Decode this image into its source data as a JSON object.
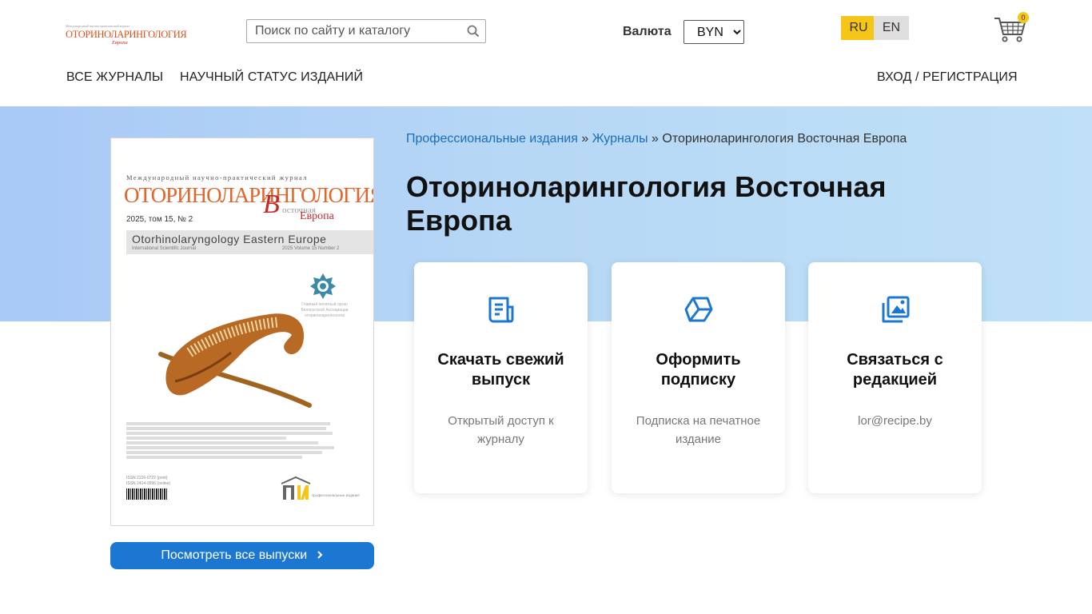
{
  "header": {
    "logo": {
      "small": "Международный научно-практический журнал",
      "main": "ОТОРИНОЛАРИНГОЛОГИЯ",
      "sub": "Европа"
    },
    "search": {
      "placeholder": "Поиск по сайту и каталогу"
    },
    "currency": {
      "label": "Валюта",
      "selected": "BYN"
    },
    "languages": [
      {
        "code": "RU",
        "active": true
      },
      {
        "code": "EN",
        "active": false
      }
    ],
    "cart": {
      "count": "0"
    },
    "nav": [
      {
        "label": "ВСЕ ЖУРНАЛЫ"
      },
      {
        "label": "НАУЧНЫЙ СТАТУС ИЗДАНИЙ"
      }
    ],
    "auth_label": "ВХОД / РЕГИСТРАЦИЯ"
  },
  "cover": {
    "intl": "Международный научно-практический журнал",
    "title": "ОТОРИНОЛАРИНГОЛОГИЯ",
    "b_letter": "В",
    "vostochnaya": "осточная",
    "evropa": "Европа",
    "year": "2025, том 15, № 2",
    "en_title": "Otorhinolaryngology  Eastern  Europe",
    "en_sub": "International Scientific Journal",
    "en_vol": "2025  Volume 15  Number 2",
    "org": "Главный печатный орган Белорусской Ассоциации оториноларингологов",
    "issn": "ISSN 2226-0722 (print)\nISSN 2414-3596 (online)",
    "publisher": "профессиональные издания"
  },
  "all_issues_label": "Посмотреть все выпуски",
  "breadcrumb": {
    "items": [
      "Профессиональные издания",
      "Журналы"
    ],
    "separator": "»",
    "current": "Оториноларингология Восточная Европа"
  },
  "page_title": "Оториноларингология Восточная Европа",
  "cards": [
    {
      "icon": "newspaper-icon",
      "title": "Скачать свежий выпуск",
      "desc": "Открытый доступ к журналу"
    },
    {
      "icon": "cube-icon",
      "title": "Оформить подписку",
      "desc": "Подписка на печатное издание"
    },
    {
      "icon": "gallery-icon",
      "title": "Связаться с редакцией",
      "desc": "lor@recipe.by"
    }
  ],
  "colors": {
    "accent": "#1b77d2",
    "lang_active": "#f5c518",
    "hero_bg": "#b7d8f5"
  }
}
